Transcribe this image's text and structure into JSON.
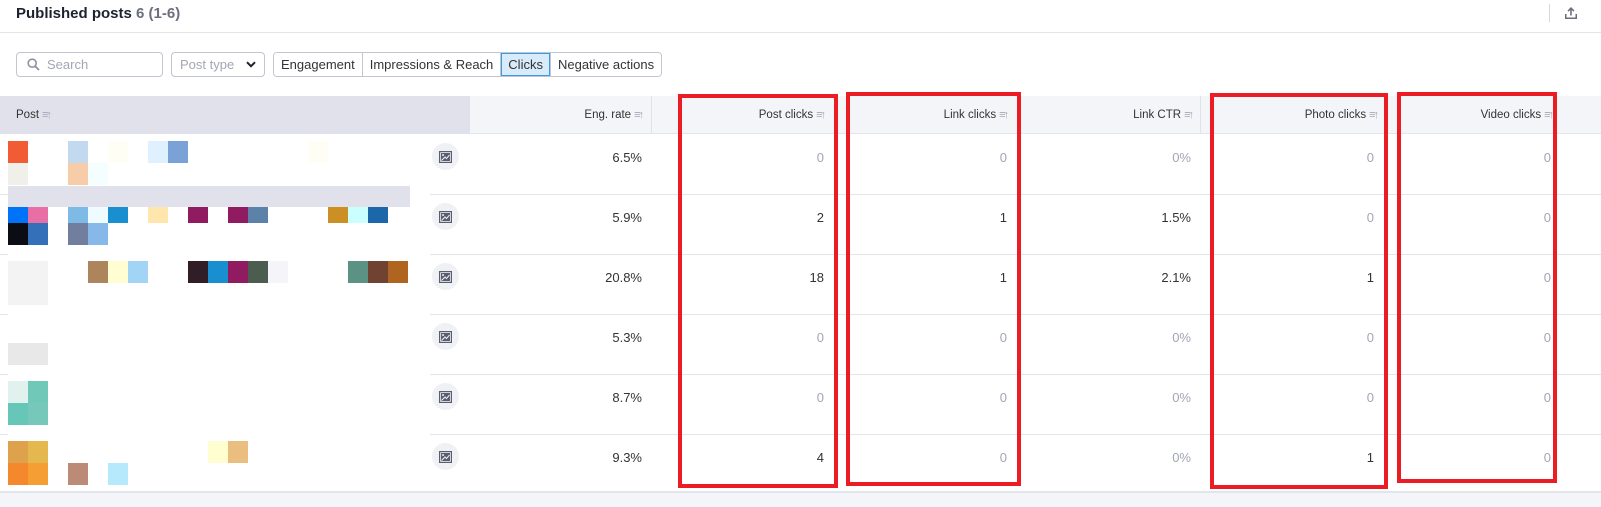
{
  "header": {
    "title": "Published posts",
    "count": "6 (1-6)",
    "export_icon": "export-upload-icon"
  },
  "toolbar": {
    "search_placeholder": "Search",
    "search_value": "",
    "post_type_label": "Post type",
    "tabs": [
      {
        "label": "Engagement",
        "active": false
      },
      {
        "label": "Impressions & Reach",
        "active": false
      },
      {
        "label": "Clicks",
        "active": true
      },
      {
        "label": "Negative actions",
        "active": false
      }
    ]
  },
  "table": {
    "columns": [
      "Post",
      "Eng. rate",
      "Post clicks",
      "Link clicks",
      "Link CTR",
      "Photo clicks",
      "Video clicks"
    ],
    "rows": [
      {
        "type_icon": "image-icon",
        "eng_rate": "6.5%",
        "post_clicks": "0",
        "link_clicks": "0",
        "link_ctr": "0%",
        "photo_clicks": "0",
        "video_clicks": "0"
      },
      {
        "type_icon": "image-icon",
        "eng_rate": "5.9%",
        "post_clicks": "2",
        "link_clicks": "1",
        "link_ctr": "1.5%",
        "photo_clicks": "0",
        "video_clicks": "0"
      },
      {
        "type_icon": "image-icon",
        "eng_rate": "20.8%",
        "post_clicks": "18",
        "link_clicks": "1",
        "link_ctr": "2.1%",
        "photo_clicks": "1",
        "video_clicks": "0"
      },
      {
        "type_icon": "image-icon",
        "eng_rate": "5.3%",
        "post_clicks": "0",
        "link_clicks": "0",
        "link_ctr": "0%",
        "photo_clicks": "0",
        "video_clicks": "0"
      },
      {
        "type_icon": "image-icon",
        "eng_rate": "8.7%",
        "post_clicks": "0",
        "link_clicks": "0",
        "link_ctr": "0%",
        "photo_clicks": "0",
        "video_clicks": "0"
      },
      {
        "type_icon": "image-icon",
        "eng_rate": "9.3%",
        "post_clicks": "4",
        "link_clicks": "0",
        "link_ctr": "0%",
        "photo_clicks": "1",
        "video_clicks": "0"
      }
    ]
  },
  "colors": {
    "highlight": "#ec1c24",
    "active_tab_bg": "#d7ebfa",
    "active_tab_border": "#3c9ade",
    "header_bg": "#f4f5f9",
    "post_header_bg": "#e0e1ea",
    "zero_text": "#a3a6b4"
  },
  "thumbnails": [
    [
      [
        "#f15c35",
        0,
        0
      ],
      [
        "#f0efe9",
        0,
        1
      ],
      [
        "#c3d9ef",
        3,
        0
      ],
      [
        "#f6cda8",
        3,
        1
      ],
      [
        "#fffef4",
        5,
        0
      ],
      [
        "#f4feff",
        4,
        1
      ],
      [
        "#dff0fe",
        7,
        0
      ],
      [
        "#7aa2d6",
        8,
        0
      ],
      [
        "#fffef4",
        15,
        0
      ]
    ],
    [
      [
        "#0074f8",
        0,
        0
      ],
      [
        "#e86ea6",
        1,
        0
      ],
      [
        "#0c0c14",
        0,
        1
      ],
      [
        "#346fb9",
        1,
        1
      ],
      [
        "#7dbae6",
        3,
        0
      ],
      [
        "#effcff",
        4,
        0
      ],
      [
        "#1a8fd0",
        5,
        0
      ],
      [
        "#727e9e",
        3,
        1
      ],
      [
        "#86b8ea",
        4,
        1
      ],
      [
        "#ffe6ad",
        7,
        0
      ],
      [
        "#901b60",
        9,
        0
      ],
      [
        "#901b60",
        11,
        0
      ],
      [
        "#5c82aa",
        12,
        0
      ],
      [
        "#cc8f24",
        16,
        0
      ],
      [
        "#cbfefe",
        17,
        0
      ],
      [
        "#1c67aa",
        18,
        0
      ]
    ],
    [
      [
        "#f3f3f3",
        0,
        0
      ],
      [
        "#f3f3f3",
        1,
        0
      ],
      [
        "#f3f3f3",
        0,
        1
      ],
      [
        "#f3f3f3",
        1,
        1
      ],
      [
        "#ad855c",
        4,
        0
      ],
      [
        "#fffed2",
        5,
        0
      ],
      [
        "#a2d4f6",
        6,
        0
      ],
      [
        "#311d25",
        9,
        0
      ],
      [
        "#1a8fd0",
        10,
        0
      ],
      [
        "#901b60",
        11,
        0
      ],
      [
        "#4c5c4f",
        12,
        0
      ],
      [
        "#f4f4f9",
        13,
        0
      ],
      [
        "#5c9283",
        17,
        0
      ],
      [
        "#704231",
        18,
        0
      ],
      [
        "#af6520",
        19,
        0
      ]
    ],
    [
      [
        "#e8e8e8",
        0,
        1
      ],
      [
        "#e8e8e8",
        1,
        1
      ]
    ],
    [
      [
        "#e1f1ed",
        0,
        0
      ],
      [
        "#70c9b8",
        1,
        0
      ],
      [
        "#66c6b7",
        0,
        1
      ],
      [
        "#76c9ba",
        1,
        1
      ]
    ],
    [
      [
        "#dda24b",
        0,
        0
      ],
      [
        "#e5b84f",
        1,
        0
      ],
      [
        "#f5882d",
        0,
        1
      ],
      [
        "#f59e34",
        1,
        1
      ],
      [
        "#bc8b78",
        3,
        1
      ],
      [
        "#b7e9fc",
        5,
        1
      ],
      [
        "#fffed1",
        10,
        0
      ],
      [
        "#eabe7e",
        11,
        0
      ]
    ]
  ]
}
